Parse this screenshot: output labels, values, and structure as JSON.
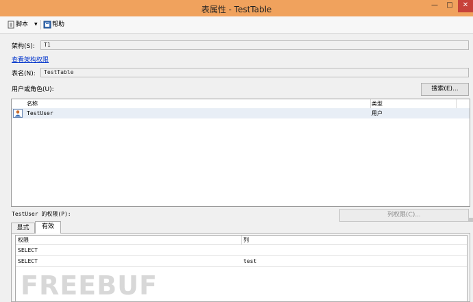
{
  "window": {
    "title": "表属性 - TestTable",
    "minimize_glyph": "—",
    "maximize_glyph": "□",
    "close_glyph": "✕"
  },
  "toolbar": {
    "script_label": "脚本",
    "script_dropdown_glyph": "▼",
    "help_label": "帮助"
  },
  "form": {
    "schema_label": "架构(S):",
    "schema_value": "T1",
    "view_schema_permissions_link": "查看架构权限",
    "table_name_label": "表名(N):",
    "table_name_value": "TestTable",
    "users_roles_label": "用户或角色(U):",
    "search_button": "搜索(E)..."
  },
  "users_grid": {
    "columns": [
      "名称",
      "类型"
    ],
    "rows": [
      {
        "name": "TestUser",
        "type": "用户"
      }
    ]
  },
  "permissions": {
    "label": "TestUser 的权限(P):",
    "column_permissions_button": "列权限(C)...",
    "tabs": [
      {
        "label": "显式",
        "active": false
      },
      {
        "label": "有效",
        "active": true
      }
    ],
    "columns": [
      "权限",
      "列"
    ],
    "rows": [
      {
        "permission": "SELECT",
        "column": ""
      },
      {
        "permission": "SELECT",
        "column": "test"
      }
    ]
  },
  "watermark": "FREEBUF"
}
